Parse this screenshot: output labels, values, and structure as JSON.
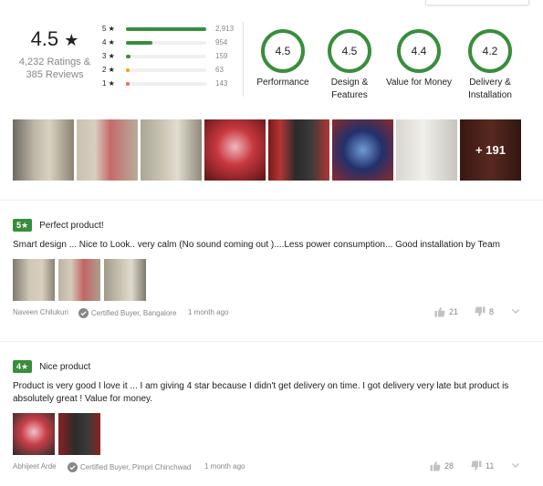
{
  "summary": {
    "rating": "4.5",
    "star": "★",
    "ratings_count": "4,232 Ratings &",
    "reviews_count": "385 Reviews"
  },
  "distribution": [
    {
      "label": "5 ★",
      "count": "2,913",
      "fraction": 1.0,
      "color": "#388e3c"
    },
    {
      "label": "4 ★",
      "count": "954",
      "fraction": 0.33,
      "color": "#388e3c"
    },
    {
      "label": "3 ★",
      "count": "159",
      "fraction": 0.06,
      "color": "#388e3c"
    },
    {
      "label": "2 ★",
      "count": "63",
      "fraction": 0.02,
      "color": "#ff9f00"
    },
    {
      "label": "1 ★",
      "count": "143",
      "fraction": 0.05,
      "color": "#ff6161"
    }
  ],
  "aspects": [
    {
      "score": "4.5",
      "label": "Performance"
    },
    {
      "score": "4.5",
      "label": "Design & Features"
    },
    {
      "score": "4.4",
      "label": "Value for Money"
    },
    {
      "score": "4.2",
      "label": "Delivery & Installation"
    }
  ],
  "photos": {
    "more_label": "+ 191"
  },
  "reviews": [
    {
      "rating": "5★",
      "title": "Perfect product!",
      "text": "Smart design ... Nice to Look.. very calm (No sound coming out )....Less power consumption... Good installation by Team",
      "author": "Naveen Chilukuri",
      "certified": "Certified Buyer, Bangalore",
      "date": "1 month ago",
      "likes": "21",
      "dislikes": "8"
    },
    {
      "rating": "4★",
      "title": "Nice product",
      "text": "Product is very good I love it ... I am giving 4 star because I didn't get delivery on time. I got delivery very late but product is absolutely great ! Value for money.",
      "author": "Abhijeet Arde",
      "certified": "Certified Buyer, Pimpri Chinchwad",
      "date": "1 month ago",
      "likes": "28",
      "dislikes": "11"
    }
  ],
  "colors": {
    "accent_green": "#388e3c",
    "muted_text": "#878787",
    "ring_green": "#388e3c"
  }
}
